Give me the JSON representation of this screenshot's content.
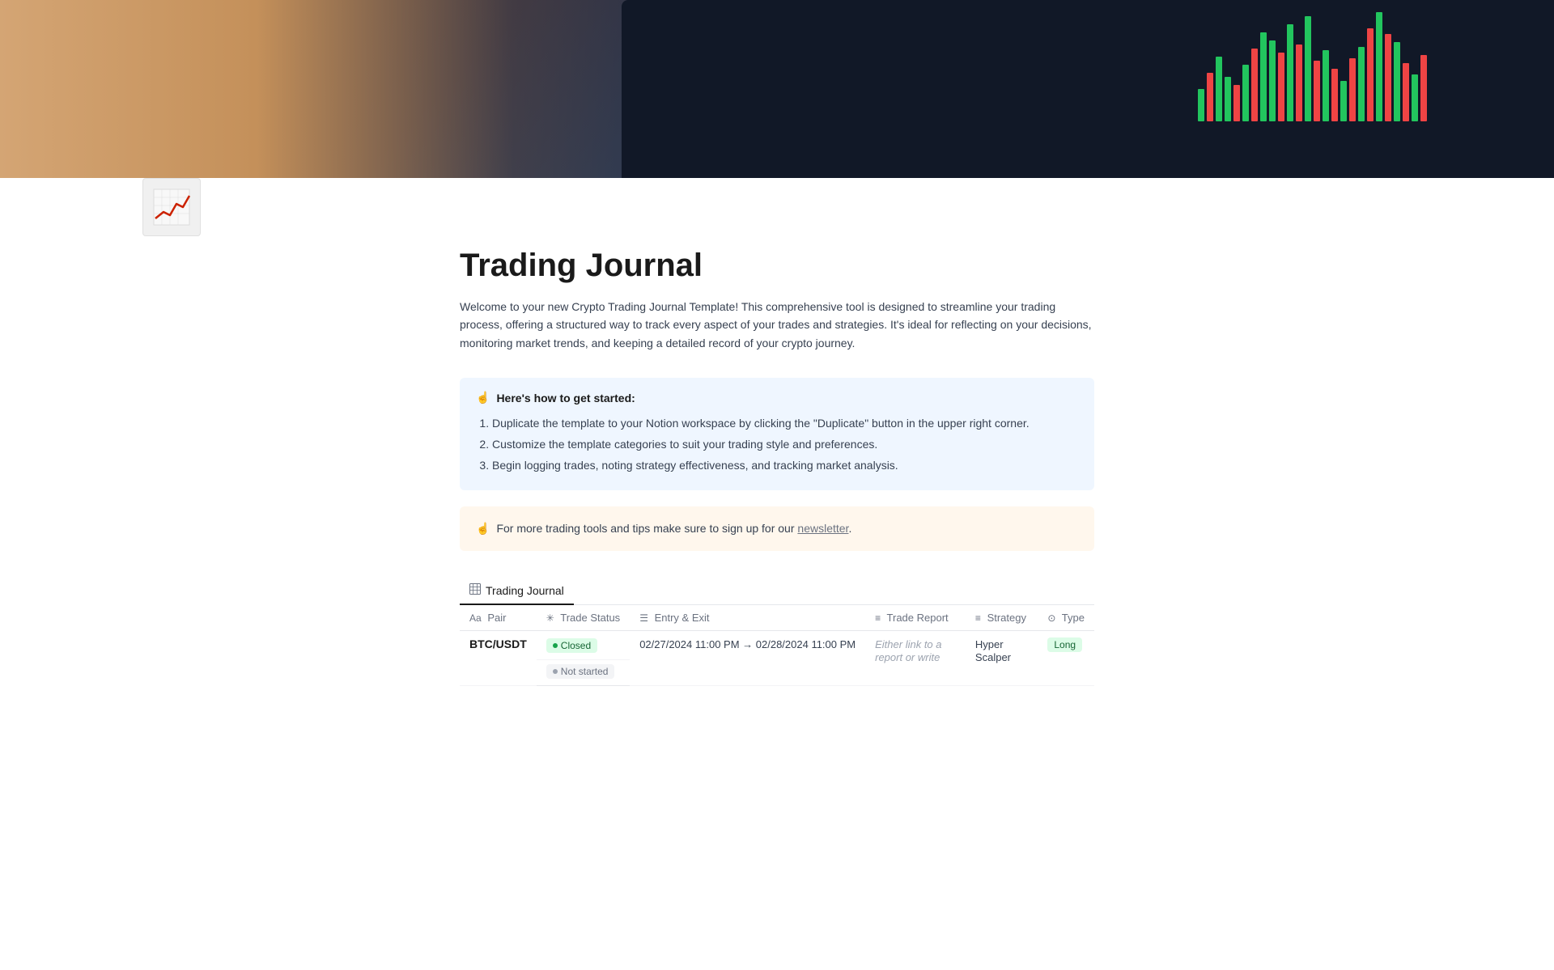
{
  "hero": {
    "alt": "Crypto trading screen with candlestick charts"
  },
  "page": {
    "icon_alt": "Trading chart icon",
    "title": "Trading Journal",
    "description": "Welcome to your new Crypto Trading Journal Template! This comprehensive tool is designed to streamline your trading process, offering a structured way to track every aspect of your trades and strategies. It's ideal for reflecting on your decisions, monitoring market trends, and keeping a detailed record of your crypto journey."
  },
  "info_box_blue": {
    "emoji": "☝️",
    "header": "Here's how to get started:",
    "steps": [
      "Duplicate the template to your Notion workspace by clicking the \"Duplicate\" button in the upper right corner.",
      "Customize the template categories to suit your trading style and preferences.",
      "Begin logging trades, noting strategy effectiveness, and tracking market analysis."
    ]
  },
  "info_box_orange": {
    "emoji": "☝️",
    "text_before": "For more trading tools and tips make sure to sign up for our ",
    "link_text": "newsletter",
    "text_after": "."
  },
  "table": {
    "tab_label": "Trading Journal",
    "tab_icon": "⊞",
    "columns": [
      {
        "icon": "Aa",
        "label": "Pair"
      },
      {
        "icon": "✳",
        "label": "Trade Status"
      },
      {
        "icon": "☰",
        "label": "Entry & Exit"
      },
      {
        "icon": "≡",
        "label": "Trade Report"
      },
      {
        "icon": "≡",
        "label": "Strategy"
      },
      {
        "icon": "⊙",
        "label": "Type"
      }
    ],
    "rows": [
      {
        "pair": "BTC/USDT",
        "status": "Closed",
        "status_type": "closed",
        "entry_exit": "02/27/2024 11:00 PM → 02/28/2024 11:00 PM",
        "trade_report": "Either link to a report or write",
        "strategy": "Hyper Scalper",
        "type": "Long",
        "type_badge": "long"
      }
    ],
    "second_row_status": "Not started",
    "second_row_status_type": "not-started"
  }
}
